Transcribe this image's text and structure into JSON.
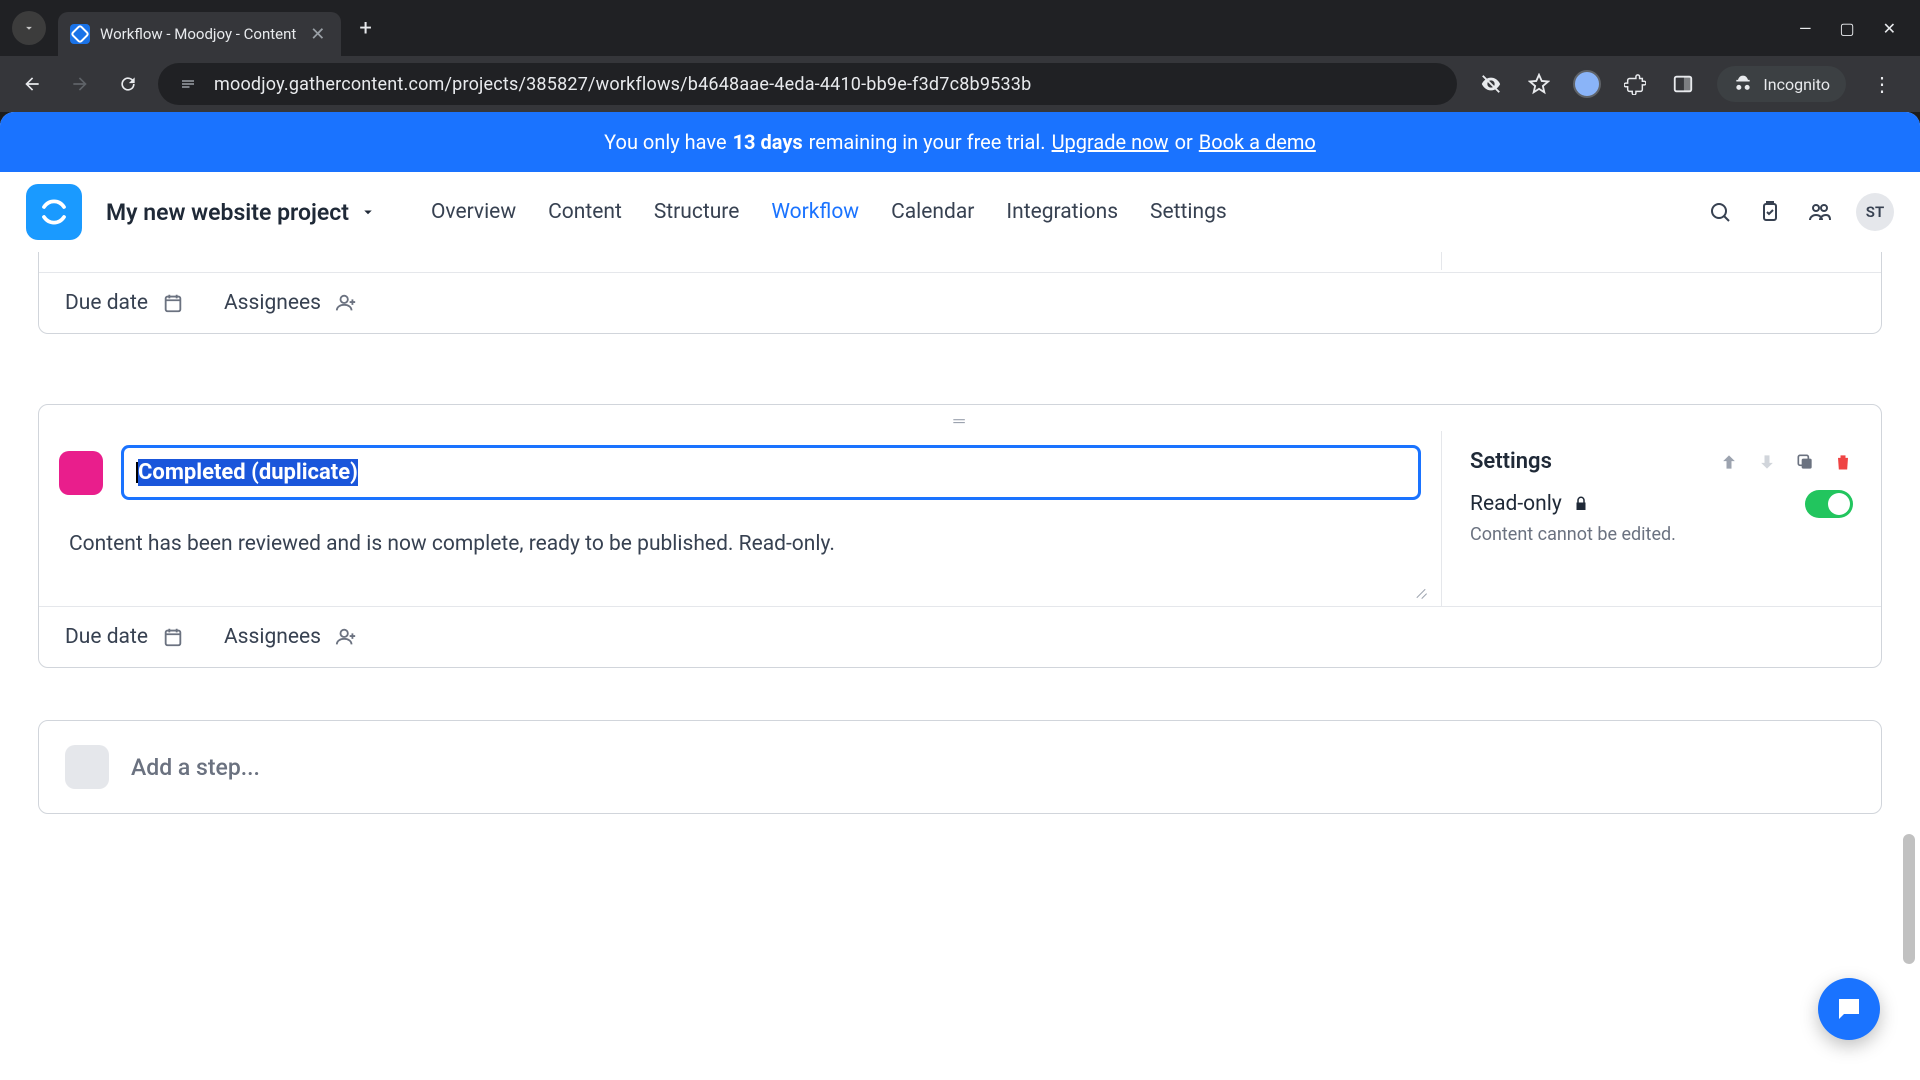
{
  "browser": {
    "tab_title": "Workflow - Moodjoy - Content",
    "url": "moodjoy.gathercontent.com/projects/385827/workflows/b4648aae-4eda-4410-bb9e-f3d7c8b9533b",
    "incognito_label": "Incognito"
  },
  "banner": {
    "pre": "You only have",
    "days": "13 days",
    "post": "remaining in your free trial.",
    "upgrade": "Upgrade now",
    "or": "or",
    "demo": "Book a demo"
  },
  "header": {
    "project_name": "My new website project",
    "nav": {
      "overview": "Overview",
      "content": "Content",
      "structure": "Structure",
      "workflow": "Workflow",
      "calendar": "Calendar",
      "integrations": "Integrations",
      "settings": "Settings"
    },
    "avatar_initials": "ST"
  },
  "labels": {
    "due_date": "Due date",
    "assignees": "Assignees"
  },
  "step": {
    "color": "#e91e8c",
    "name": "Completed (duplicate)",
    "description": "Content has been reviewed and is now complete, ready to be published. Read-only.",
    "settings_title": "Settings",
    "readonly_label": "Read-only",
    "readonly_help": "Content cannot be edited."
  },
  "add_step": {
    "placeholder": "Add a step..."
  }
}
